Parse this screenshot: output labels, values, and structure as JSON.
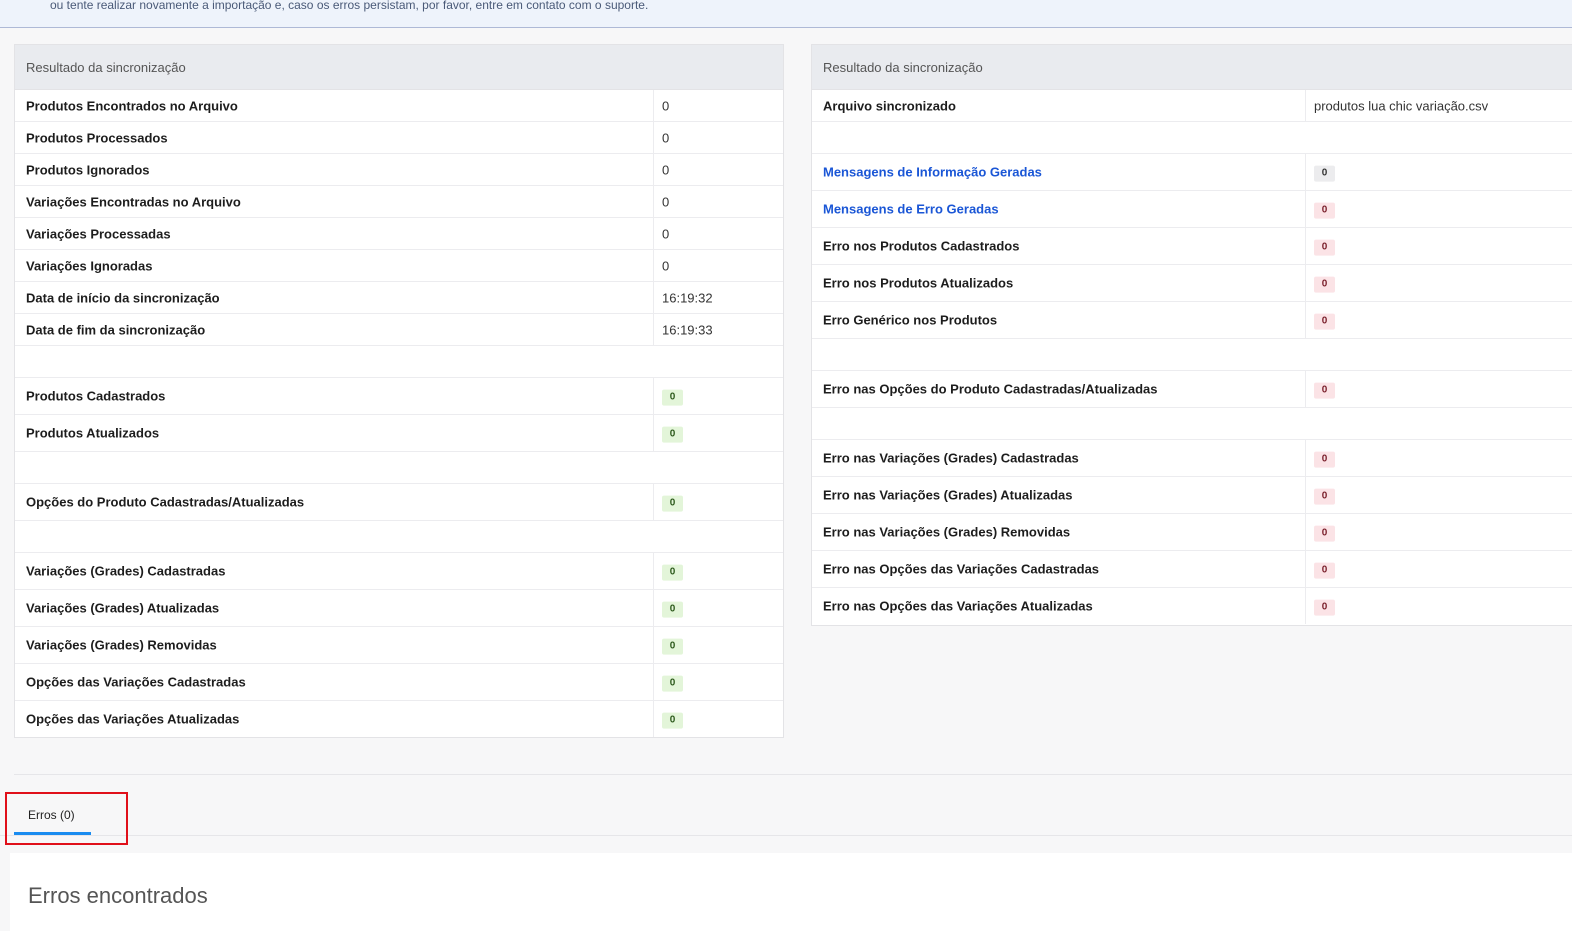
{
  "alert": {
    "text": "ou tente realizar novamente a importação e, caso os erros persistam, por favor, entre em contato com o suporte."
  },
  "left_panel": {
    "title": "Resultado da sincronização",
    "rows": [
      {
        "label": "Produtos Encontrados no Arquivo",
        "value": "0"
      },
      {
        "label": "Produtos Processados",
        "value": "0"
      },
      {
        "label": "Produtos Ignorados",
        "value": "0"
      },
      {
        "label": "Variações Encontradas no Arquivo",
        "value": "0"
      },
      {
        "label": "Variações Processadas",
        "value": "0"
      },
      {
        "label": "Variações Ignoradas",
        "value": "0"
      },
      {
        "label": "Data de início da sincronização",
        "value": "16:19:32"
      },
      {
        "label": "Data de fim da sincronização",
        "value": "16:19:33"
      },
      {
        "label": "Produtos Cadastrados",
        "badge": "0"
      },
      {
        "label": "Produtos Atualizados",
        "badge": "0"
      },
      {
        "label": "Opções do Produto Cadastradas/Atualizadas",
        "badge": "0"
      },
      {
        "label": "Variações (Grades) Cadastradas",
        "badge": "0"
      },
      {
        "label": "Variações (Grades) Atualizadas",
        "badge": "0"
      },
      {
        "label": "Variações (Grades) Removidas",
        "badge": "0"
      },
      {
        "label": "Opções das Variações Cadastradas",
        "badge": "0"
      },
      {
        "label": "Opções das Variações Atualizadas",
        "badge": "0"
      }
    ]
  },
  "right_panel": {
    "title": "Resultado da sincronização",
    "rows": [
      {
        "label": "Arquivo sincronizado",
        "value": "produtos lua chic variação.csv"
      },
      {
        "label": "Mensagens de Informação Geradas",
        "badge": "0"
      },
      {
        "label": "Mensagens de Erro Geradas",
        "badge": "0"
      },
      {
        "label": "Erro nos Produtos Cadastrados",
        "badge": "0"
      },
      {
        "label": "Erro nos Produtos Atualizados",
        "badge": "0"
      },
      {
        "label": "Erro Genérico nos Produtos",
        "badge": "0"
      },
      {
        "label": "Erro nas Opções do Produto Cadastradas/Atualizadas",
        "badge": "0"
      },
      {
        "label": "Erro nas Variações (Grades) Cadastradas",
        "badge": "0"
      },
      {
        "label": "Erro nas Variações (Grades) Atualizadas",
        "badge": "0"
      },
      {
        "label": "Erro nas Variações (Grades) Removidas",
        "badge": "0"
      },
      {
        "label": "Erro nas Opções das Variações Cadastradas",
        "badge": "0"
      },
      {
        "label": "Erro nas Opções das Variações Atualizadas",
        "badge": "0"
      }
    ]
  },
  "tabs": [
    {
      "label": "Erros (0)"
    }
  ],
  "errors_section": {
    "title": "Erros encontrados"
  },
  "colors": {
    "link": "#1a56d6",
    "tab_active": "#1a8cf0",
    "highlight": "#e0101a",
    "badge_success_bg": "#e3f5d9",
    "badge_error_bg": "#fbe3e6"
  }
}
